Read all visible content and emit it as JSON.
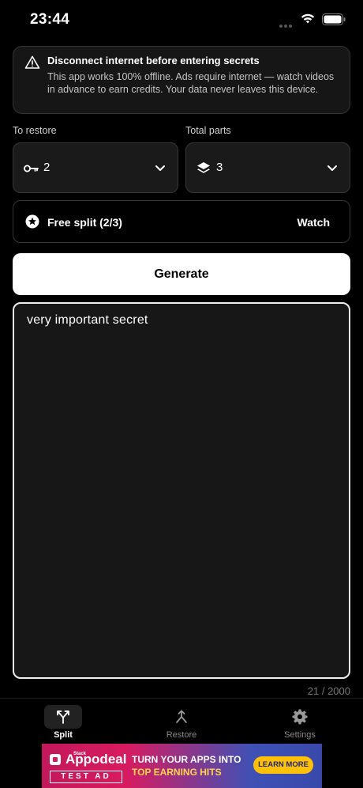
{
  "status_bar": {
    "time": "23:44"
  },
  "warning": {
    "icon": "warning-triangle-icon",
    "title": "Disconnect internet before entering secrets",
    "body": "This app works 100% offline. Ads require internet — watch videos in advance to earn credits. Your data never leaves this device."
  },
  "to_restore": {
    "label": "To restore",
    "icon": "key-icon",
    "value": "2"
  },
  "total_parts": {
    "label": "Total parts",
    "icon": "layers-icon",
    "value": "3"
  },
  "free_split": {
    "icon": "star-icon",
    "label": "Free split (2/3)",
    "action": "Watch"
  },
  "generate": {
    "label": "Generate"
  },
  "secret_input": {
    "value": "very important secret",
    "counter": "21 / 2000"
  },
  "tabs": [
    {
      "label": "Split",
      "icon": "split-icon",
      "active": true
    },
    {
      "label": "Restore",
      "icon": "merge-icon",
      "active": false
    },
    {
      "label": "Settings",
      "icon": "gear-icon",
      "active": false
    }
  ],
  "ad": {
    "small_label": "Stack",
    "brand": "Appodeal",
    "test_label": "TEST AD",
    "headline_1": "TURN YOUR APPS INTO",
    "headline_2": "TOP EARNING HITS",
    "cta": "LEARN MORE"
  },
  "colors": {
    "background": "#000000",
    "card": "#1a1a1a",
    "border": "#363636",
    "primary_button": "#ffffff",
    "ad_gradient_start": "#d81b60",
    "ad_gradient_end": "#3949ab",
    "ad_cta": "#ffc107"
  }
}
